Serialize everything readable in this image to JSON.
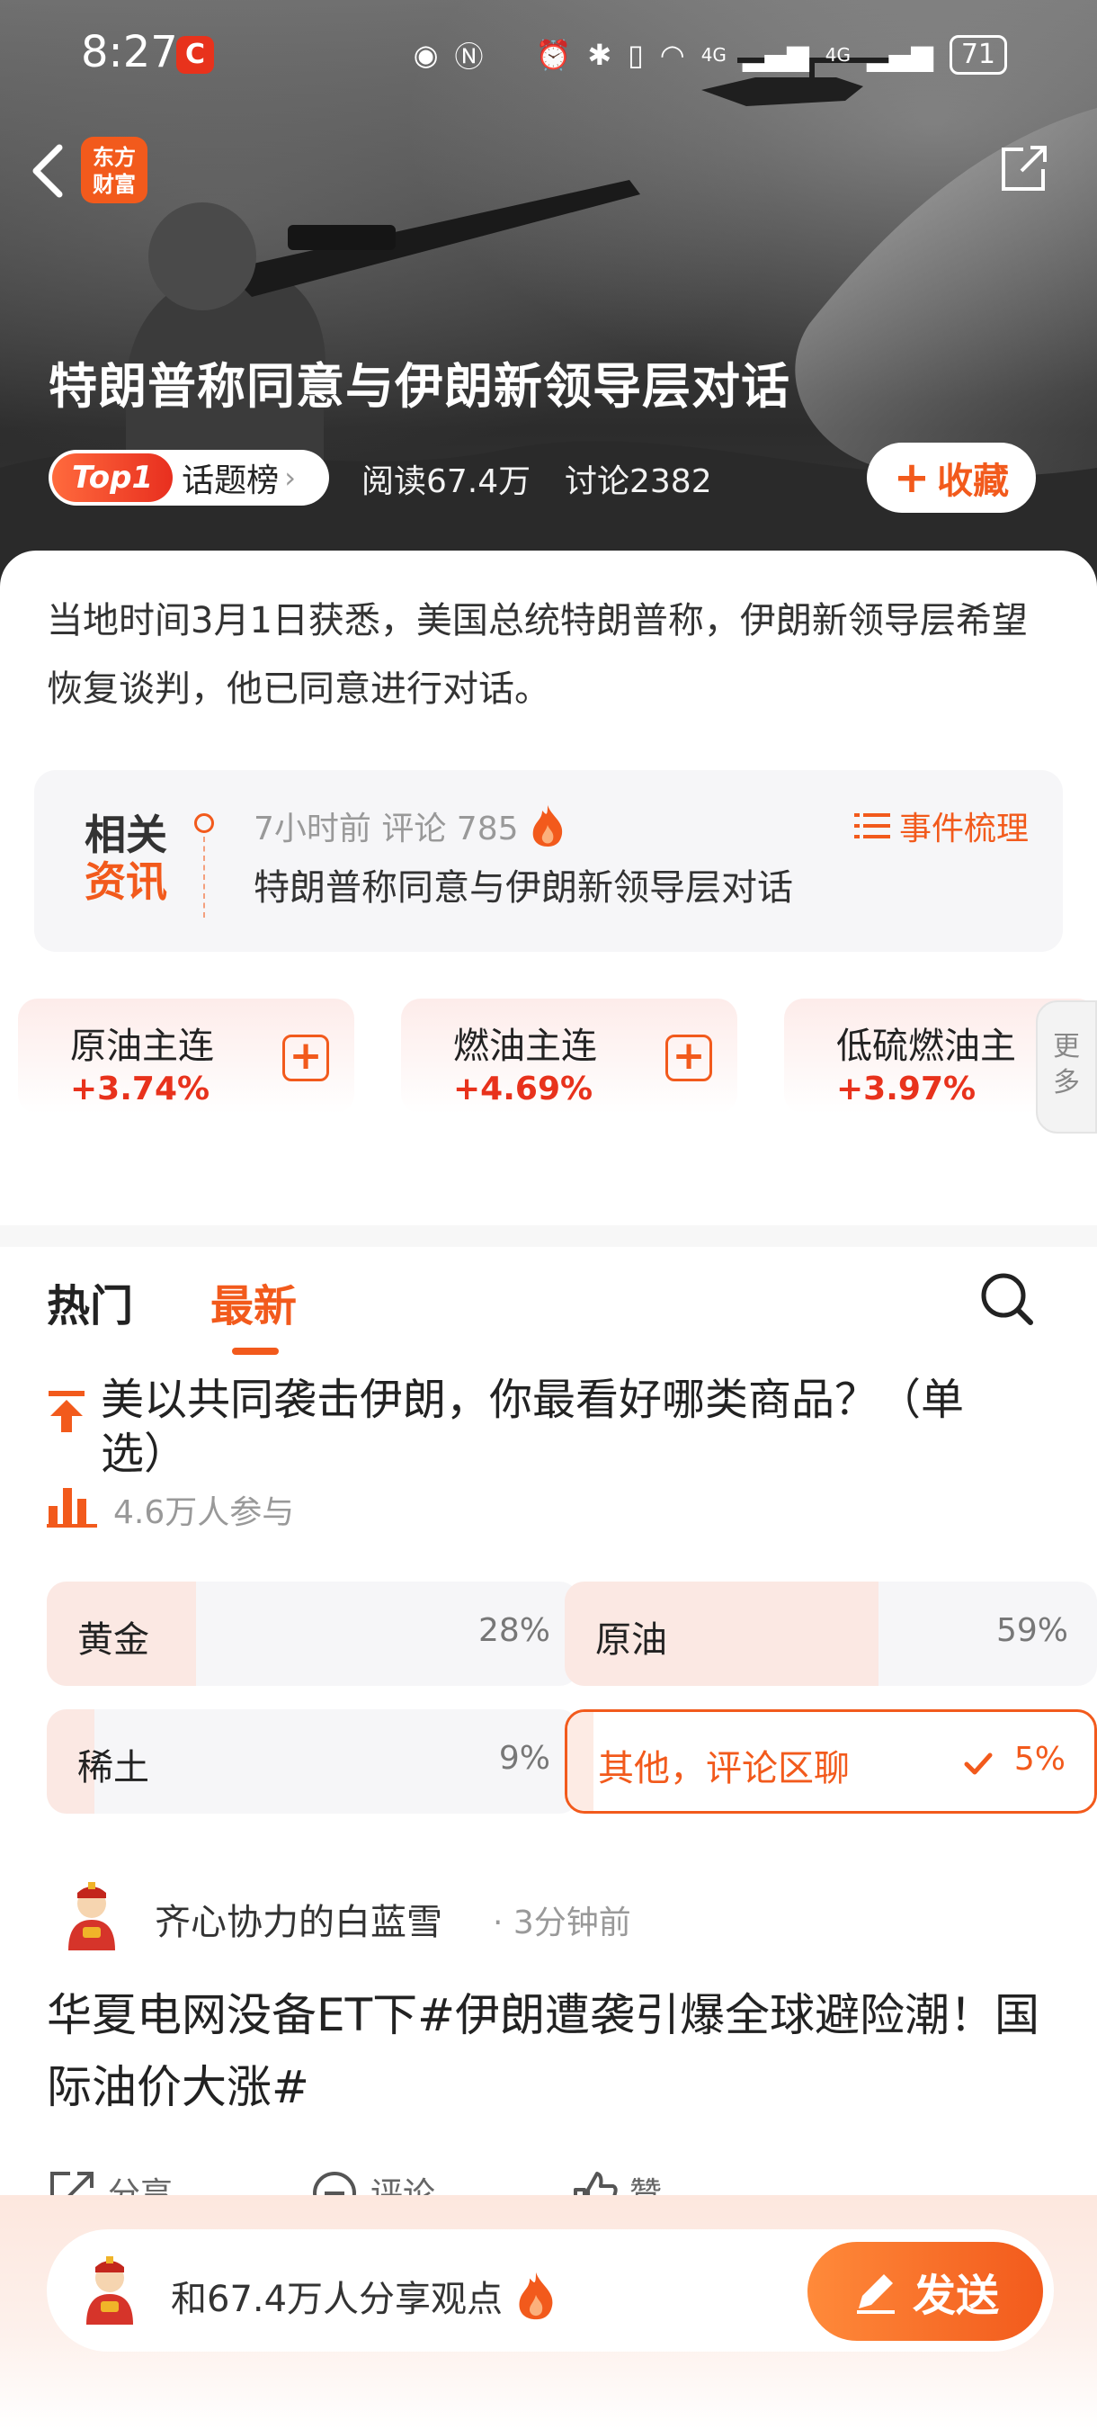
{
  "status_bar": {
    "time": "8:27",
    "app_badge": "C",
    "network_1": "4G",
    "network_2": "4G",
    "battery": "71"
  },
  "header": {
    "logo_line1": "东方",
    "logo_line2": "财富",
    "topic_title": "特朗普称同意与伊朗新领导层对话",
    "rank_badge": "Top1",
    "rank_label": "话题榜",
    "rank_chevron": "›",
    "reads": "阅读67.4万",
    "discussions": "讨论2382",
    "favorite_label": "收藏",
    "favorite_plus": "+"
  },
  "summary": {
    "text": "当地时间3月1日获悉，美国总统特朗普称，伊朗新领导层希望恢复谈判，他已同意进行对话。"
  },
  "related": {
    "logo_line1": "相关",
    "logo_line2": "资讯",
    "meta": "7小时前  评论 785",
    "headline": "特朗普称同意与伊朗新领导层对话",
    "event_label": "事件梳理"
  },
  "quotes": [
    {
      "name": "原油主连",
      "change": "+3.74%"
    },
    {
      "name": "燃油主连",
      "change": "+4.69%"
    },
    {
      "name": "低硫燃油主",
      "change": "+3.97%"
    }
  ],
  "quotes_add_symbol": "+",
  "more_tab": {
    "line1": "更",
    "line2": "多"
  },
  "tabs": {
    "hot": "热门",
    "latest": "最新"
  },
  "poll": {
    "question": "美以共同袭击伊朗，你最看好哪类商品？（单选）",
    "participants": "4.6万人参与",
    "options": [
      {
        "label": "黄金",
        "percent": "28%",
        "share": 0.28
      },
      {
        "label": "原油",
        "percent": "59%",
        "share": 0.59
      },
      {
        "label": "稀土",
        "percent": "9%",
        "share": 0.09
      },
      {
        "label": "其他，评论区聊",
        "percent": "5%",
        "share": 0.05,
        "selected": true
      }
    ]
  },
  "post": {
    "author": "齐心协力的白蓝雪",
    "time": "· 3分钟前",
    "text": "华夏电网没备ET下#伊朗遭袭引爆全球避险潮！国际油价大涨#",
    "actions": {
      "share": "分享",
      "comment": "评论",
      "like": "赞"
    }
  },
  "composer": {
    "prompt": "和67.4万人分享观点",
    "send_label": "发送"
  },
  "colors": {
    "accent": "#f25a1c",
    "rise": "#e8321c"
  }
}
